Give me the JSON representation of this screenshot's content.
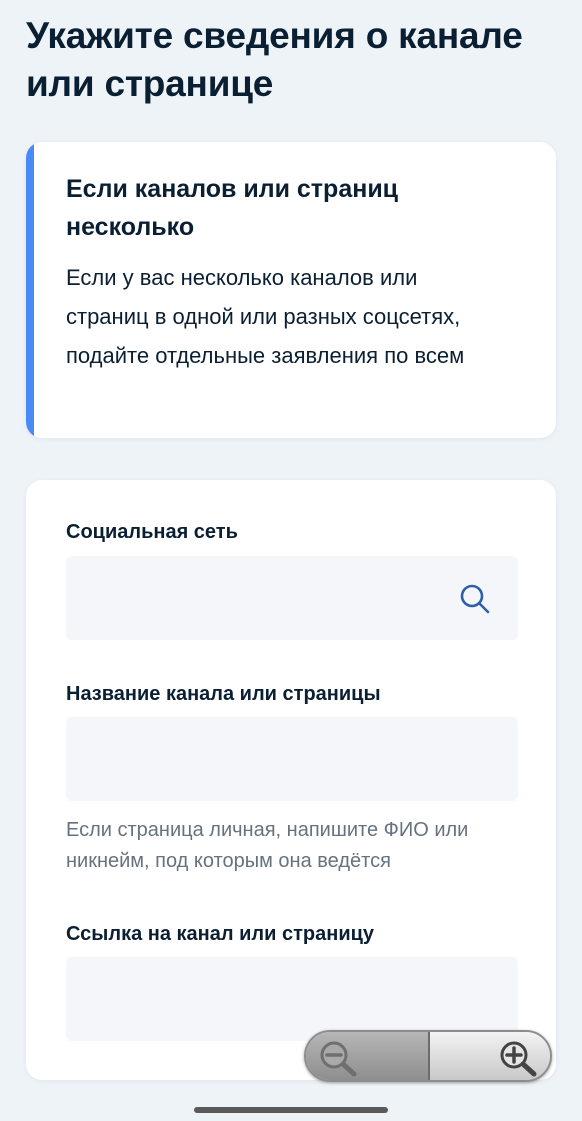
{
  "page": {
    "title": "Укажите сведения о канале или странице"
  },
  "info_card": {
    "title": "Если каналов или страниц несколько",
    "text": "Если у вас несколько каналов или страниц в одной или разных соцсетях, подайте отдельные заявления по всем",
    "accent_color": "#4a8af4"
  },
  "form": {
    "social_network": {
      "label": "Социальная сеть",
      "value": "",
      "icon": "search-icon"
    },
    "channel_name": {
      "label": "Название канала или страницы",
      "value": "",
      "hint": "Если страница личная, напишите ФИО или никнейм, под которым она ведётся"
    },
    "channel_link": {
      "label": "Ссылка на канал или страницу",
      "value": ""
    }
  },
  "zoom_control": {
    "zoom_out_icon": "zoom-out-icon",
    "zoom_in_icon": "zoom-in-icon"
  },
  "colors": {
    "background": "#eef3f8",
    "card": "#ffffff",
    "text": "#0b1f33",
    "hint": "#66727f",
    "input": "#f4f6f9",
    "link_blue": "#2f5fa8"
  }
}
